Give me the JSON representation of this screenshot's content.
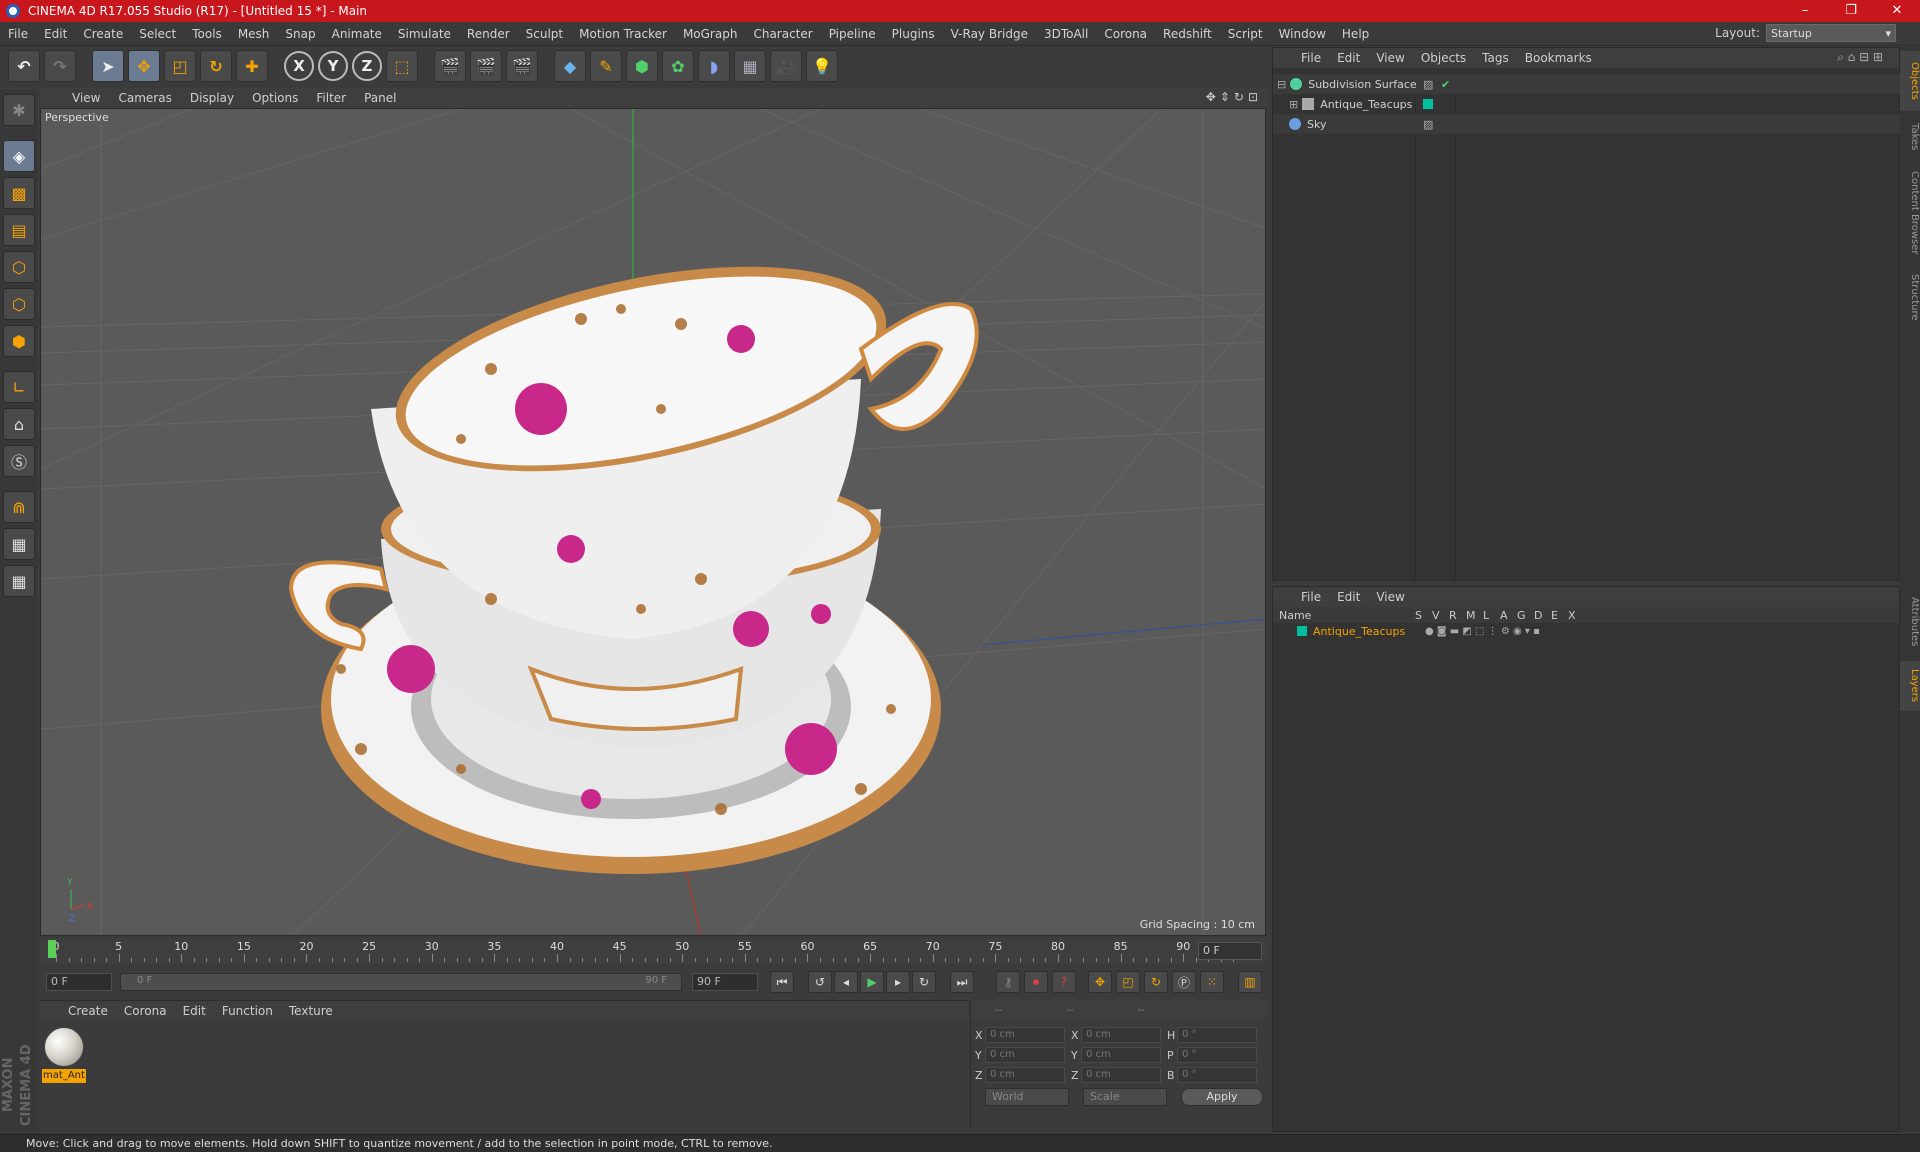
{
  "window": {
    "title": "CINEMA 4D R17.055 Studio (R17) - [Untitled 15 *] - Main",
    "controls": [
      "–",
      "❐",
      "✕"
    ]
  },
  "menubar": {
    "items": [
      "File",
      "Edit",
      "Create",
      "Select",
      "Tools",
      "Mesh",
      "Snap",
      "Animate",
      "Simulate",
      "Render",
      "Sculpt",
      "Motion Tracker",
      "MoGraph",
      "Character",
      "Pipeline",
      "Plugins",
      "V-Ray Bridge",
      "3DToAll",
      "Corona",
      "Redshift",
      "Script",
      "Window",
      "Help"
    ],
    "layout_label": "Layout:",
    "layout_value": "Startup"
  },
  "toolbar": {
    "axis_x": "X",
    "axis_y": "Y",
    "axis_z": "Z"
  },
  "viewport": {
    "menu": [
      "View",
      "Cameras",
      "Display",
      "Options",
      "Filter",
      "Panel"
    ],
    "label": "Perspective",
    "grid_spacing": "Grid Spacing : 10 cm",
    "axis_labels": [
      "Y",
      "X",
      "Z"
    ]
  },
  "timeline": {
    "labels": [
      "0",
      "5",
      "10",
      "15",
      "20",
      "25",
      "30",
      "35",
      "40",
      "45",
      "50",
      "55",
      "60",
      "65",
      "70",
      "75",
      "80",
      "85",
      "90"
    ],
    "current_frame": "0 F"
  },
  "transport": {
    "start_field": "0 F",
    "slider_start": "0 F",
    "slider_end": "90 F",
    "end_field": "90 F"
  },
  "material_manager": {
    "menu": [
      "Create",
      "Corona",
      "Edit",
      "Function",
      "Texture"
    ],
    "material_name": "mat_Ant"
  },
  "coordinates": {
    "header": [
      "--",
      "--",
      "--"
    ],
    "rows": [
      {
        "l1": "X",
        "v1": "0 cm",
        "l2": "X",
        "v2": "0 cm",
        "l3": "H",
        "v3": "0 °"
      },
      {
        "l1": "Y",
        "v1": "0 cm",
        "l2": "Y",
        "v2": "0 cm",
        "l3": "P",
        "v3": "0 °"
      },
      {
        "l1": "Z",
        "v1": "0 cm",
        "l2": "Z",
        "v2": "0 cm",
        "l3": "B",
        "v3": "0 °"
      }
    ],
    "world": "World",
    "scale": "Scale",
    "apply": "Apply"
  },
  "object_manager": {
    "menu": [
      "File",
      "Edit",
      "View",
      "Objects",
      "Tags",
      "Bookmarks"
    ],
    "objects": [
      {
        "name": "Subdivision Surface",
        "color": "#4fd0a0"
      },
      {
        "name": "Antique_Teacups",
        "color": "#aaaaaa"
      },
      {
        "name": "Sky",
        "color": "#6aa0e0"
      }
    ]
  },
  "layer_manager": {
    "menu": [
      "File",
      "Edit",
      "View"
    ],
    "columns": [
      "Name",
      "S",
      "V",
      "R",
      "M",
      "L",
      "A",
      "G",
      "D",
      "E",
      "X"
    ],
    "layers": [
      {
        "name": "Antique_Teacups",
        "color": "#00c0a0"
      }
    ]
  },
  "side_tabs": [
    "Objects",
    "Takes",
    "Content Browser",
    "Structure",
    "Attributes",
    "Layers"
  ],
  "status": "Move: Click and drag to move elements. Hold down SHIFT to quantize movement / add to the selection in point mode, CTRL to remove.",
  "brand": "MAXON CINEMA 4D"
}
